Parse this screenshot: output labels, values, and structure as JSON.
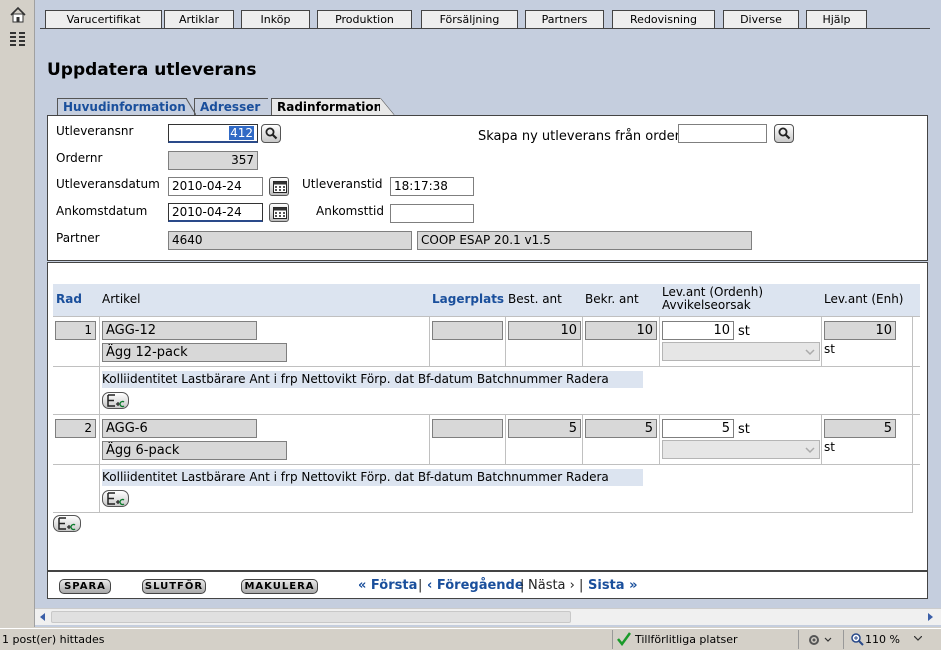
{
  "menu": [
    "Varucertifikat",
    "Artiklar",
    "Inköp",
    "Produktion",
    "Försäljning",
    "Partners",
    "Redovisning",
    "Diverse",
    "Hjälp"
  ],
  "page_title": "Uppdatera utleverans",
  "tabs": [
    "Huvudinformation",
    "Adresser",
    "Radinformation"
  ],
  "header": {
    "utleveransnr_label": "Utleveransnr",
    "utleveransnr": "412",
    "skapa_label": "Skapa ny utleverans från order",
    "skapa_value": "",
    "ordernr_label": "Ordernr",
    "ordernr": "357",
    "utleveransdatum_label": "Utleveransdatum",
    "utleveransdatum": "2010-04-24",
    "utleveranstid_label": "Utleveranstid",
    "utleveranstid": "18:17:38",
    "ankomstdatum_label": "Ankomstdatum",
    "ankomstdatum": "2010-04-24",
    "ankomsttid_label": "Ankomsttid",
    "ankomsttid": "",
    "partner_label": "Partner",
    "partner_id": "4640",
    "partner_name": "COOP ESAP 20.1 v1.5"
  },
  "table": {
    "columns": {
      "rad": "Rad",
      "artikel": "Artikel",
      "lagerplats": "Lagerplats",
      "best": "Best. ant",
      "bekr": "Bekr. ant",
      "lev_ordenh": "Lev.ant (Ordenh)",
      "avvikelse": "Avvikelseorsak",
      "lev_enh": "Lev.ant (Enh)"
    },
    "sub_columns": "Kolliidentitet Lastbärare Ant i frp Nettovikt Förp. dat Bf-datum Batchnummer Radera",
    "rows": [
      {
        "rad": "1",
        "artikel": "AGG-12",
        "beskrivning": "Ägg 12-pack",
        "lagerplats": "",
        "best": "10",
        "bekr": "10",
        "lev": "10",
        "unit": "st",
        "lev_enh": "10",
        "unit2": "st"
      },
      {
        "rad": "2",
        "artikel": "AGG-6",
        "beskrivning": "Ägg 6-pack",
        "lagerplats": "",
        "best": "5",
        "bekr": "5",
        "lev": "5",
        "unit": "st",
        "lev_enh": "5",
        "unit2": "st"
      }
    ]
  },
  "buttons": {
    "spara": "SPARA",
    "slutfor": "SLUTFÖR",
    "makulera": "MAKULERA"
  },
  "pagination": {
    "forsta": "« Första",
    "sep1": "|",
    "foregaende": "‹ Föregående",
    "sep2": "|",
    "nasta": "Nästa ›",
    "sep3": "|",
    "sista": "Sista »"
  },
  "statusbar": {
    "text": "1 post(er) hittades",
    "zone": "Tillförlitliga platser",
    "zoom": "110 %"
  }
}
